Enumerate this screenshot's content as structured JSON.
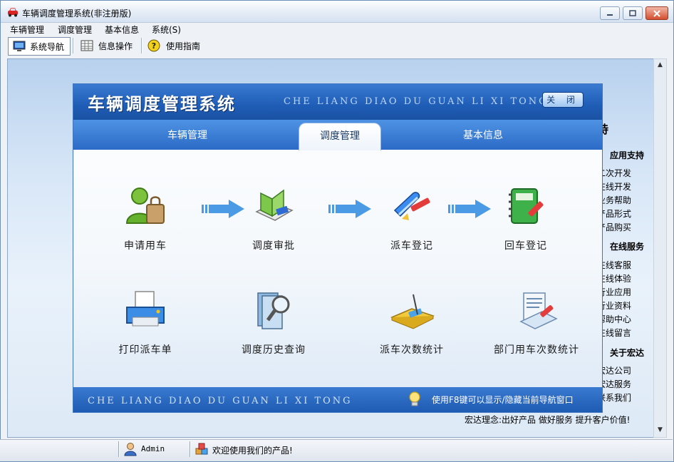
{
  "window": {
    "title": "车辆调度管理系统(非注册版)"
  },
  "menu": [
    "车辆管理",
    "调度管理",
    "基本信息",
    "系统(S)"
  ],
  "toolbar": {
    "nav": "系统导航",
    "info": "信息操作",
    "guide": "使用指南"
  },
  "nav": {
    "title": "车辆调度管理系统",
    "subtitle": "CHE LIANG DIAO DU GUAN LI XI TONG",
    "close": "关 闭",
    "tabs": [
      "车辆管理",
      "调度管理",
      "基本信息"
    ],
    "active_tab": "调度管理",
    "functions_row1": [
      "申请用车",
      "调度审批",
      "派车登记",
      "回车登记"
    ],
    "functions_row2": [
      "打印派车单",
      "调度历史查询",
      "派车次数统计",
      "部门用车次数统计"
    ],
    "footer_subtitle": "CHE LIANG DIAO DU GUAN LI XI TONG",
    "footer_tip": "使用F8键可以显示/隐藏当前导航窗口"
  },
  "side": {
    "support_title_fragment": "持",
    "app_support": "应用支持",
    "app_items": [
      "二次开发",
      "在线开发",
      "业务帮助",
      "产品形式",
      "产品购买"
    ],
    "online_service": "在线服务",
    "online_items": [
      "在线客服",
      "在线体验",
      "行业应用",
      "行业资料",
      "帮助中心",
      "在线留言"
    ],
    "about": "关于宏达",
    "about_items": [
      "宏达公司",
      "宏达服务",
      "联系我们"
    ]
  },
  "motto": "宏达理念:出好产品  做好服务  提升客户价值!",
  "status": {
    "user": "Admin",
    "welcome": "欢迎使用我们的产品!"
  },
  "colors": {
    "header_blue": "#1f5db6",
    "tab_blue": "#2b6ac6",
    "arrow_blue": "#4a9ae6"
  }
}
